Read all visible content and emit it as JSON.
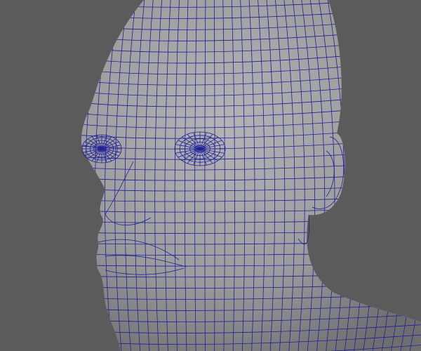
{
  "viewport": {
    "background_color": "#5b5b5b",
    "mesh_color": "#a9a9a9",
    "mesh_shadow_color": "#6e6e6e",
    "wire_color": "#1f1f9a"
  }
}
